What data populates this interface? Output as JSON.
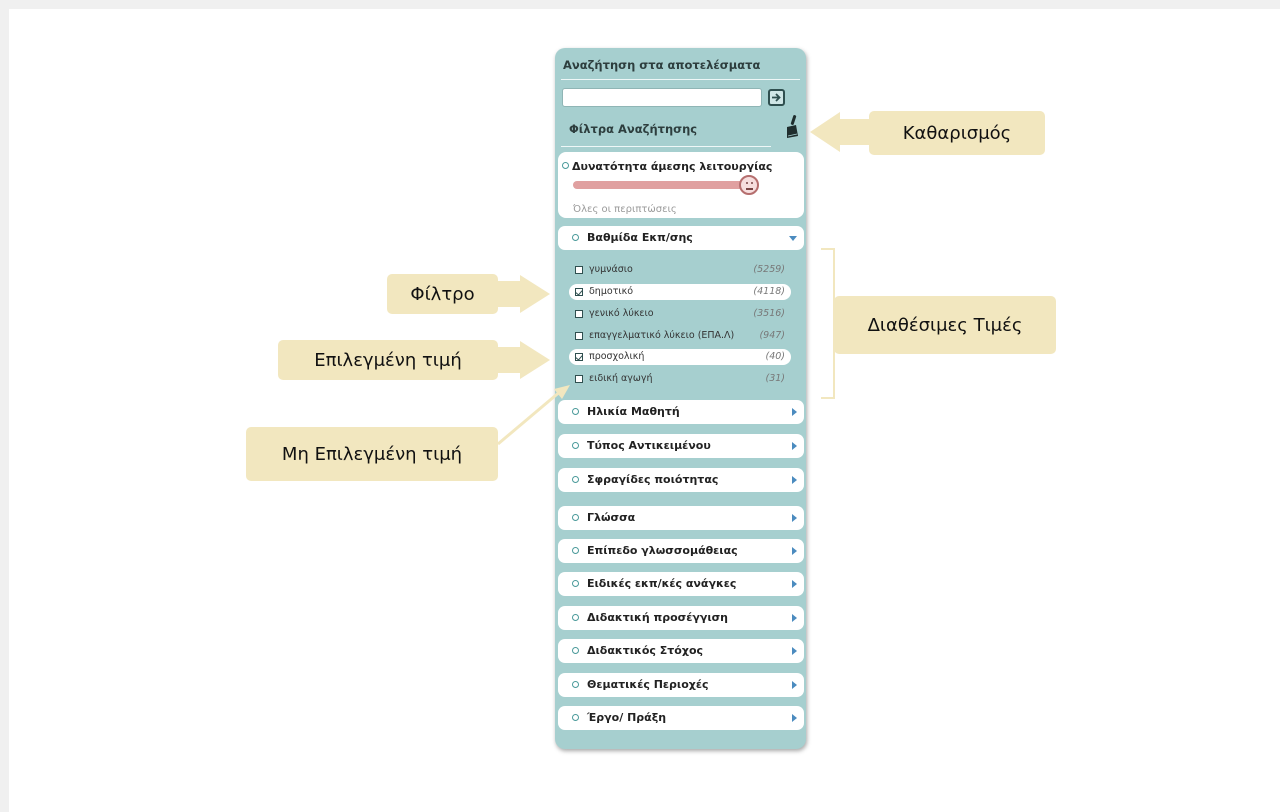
{
  "panel": {
    "title": "Αναζήτηση στα αποτελέσματα",
    "search": {
      "value": "",
      "placeholder": ""
    },
    "filters_title": "Φίλτρα Αναζήτησης"
  },
  "slider_filter": {
    "label": "Δυνατότητα άμεσης λειτουργίας",
    "note": "Όλες οι περιπτώσεις",
    "level": 1.0
  },
  "level_filter": {
    "label": "Βαθμίδα Εκπ/σης",
    "values": [
      {
        "label": "γυμνάσιο",
        "count": "(5259)",
        "selected": false
      },
      {
        "label": "δημοτικό",
        "count": "(4118)",
        "selected": true
      },
      {
        "label": "γενικό λύκειο",
        "count": "(3516)",
        "selected": false
      },
      {
        "label": "επαγγελματικό λύκειο (ΕΠΑ.Λ)",
        "count": "(947)",
        "selected": false
      },
      {
        "label": "προσχολική",
        "count": "(40)",
        "selected": true
      },
      {
        "label": "ειδική αγωγή",
        "count": "(31)",
        "selected": false
      }
    ]
  },
  "categories": [
    "Ηλικία Μαθητή",
    "Τύπος Αντικειμένου",
    "Σφραγίδες ποιότητας",
    "Γλώσσα",
    "Επίπεδο γλωσσομάθειας",
    "Ειδικές εκπ/κές ανάγκες",
    "Διδακτική προσέγγιση",
    "Διδακτικός Στόχος",
    "Θεματικές Περιοχές",
    "Έργο/ Πράξη"
  ],
  "callouts": {
    "clear": "Καθαρισμός",
    "filter": "Φίλτρο",
    "available": "Διαθέσιμες Τιμές",
    "selected": "Επιλεγμένη τιμή",
    "unselected": "Μη Επιλεγμένη τιμή"
  },
  "colors": {
    "panel": "#a6cfcf",
    "callout": "#f2e7bf",
    "slider": "#e0a0a0",
    "arrow": "#4b8bbf"
  },
  "icons": [
    "go-arrow-icon",
    "brush-icon",
    "chevron-down-icon",
    "chevron-right-icon",
    "neutral-face-icon"
  ]
}
